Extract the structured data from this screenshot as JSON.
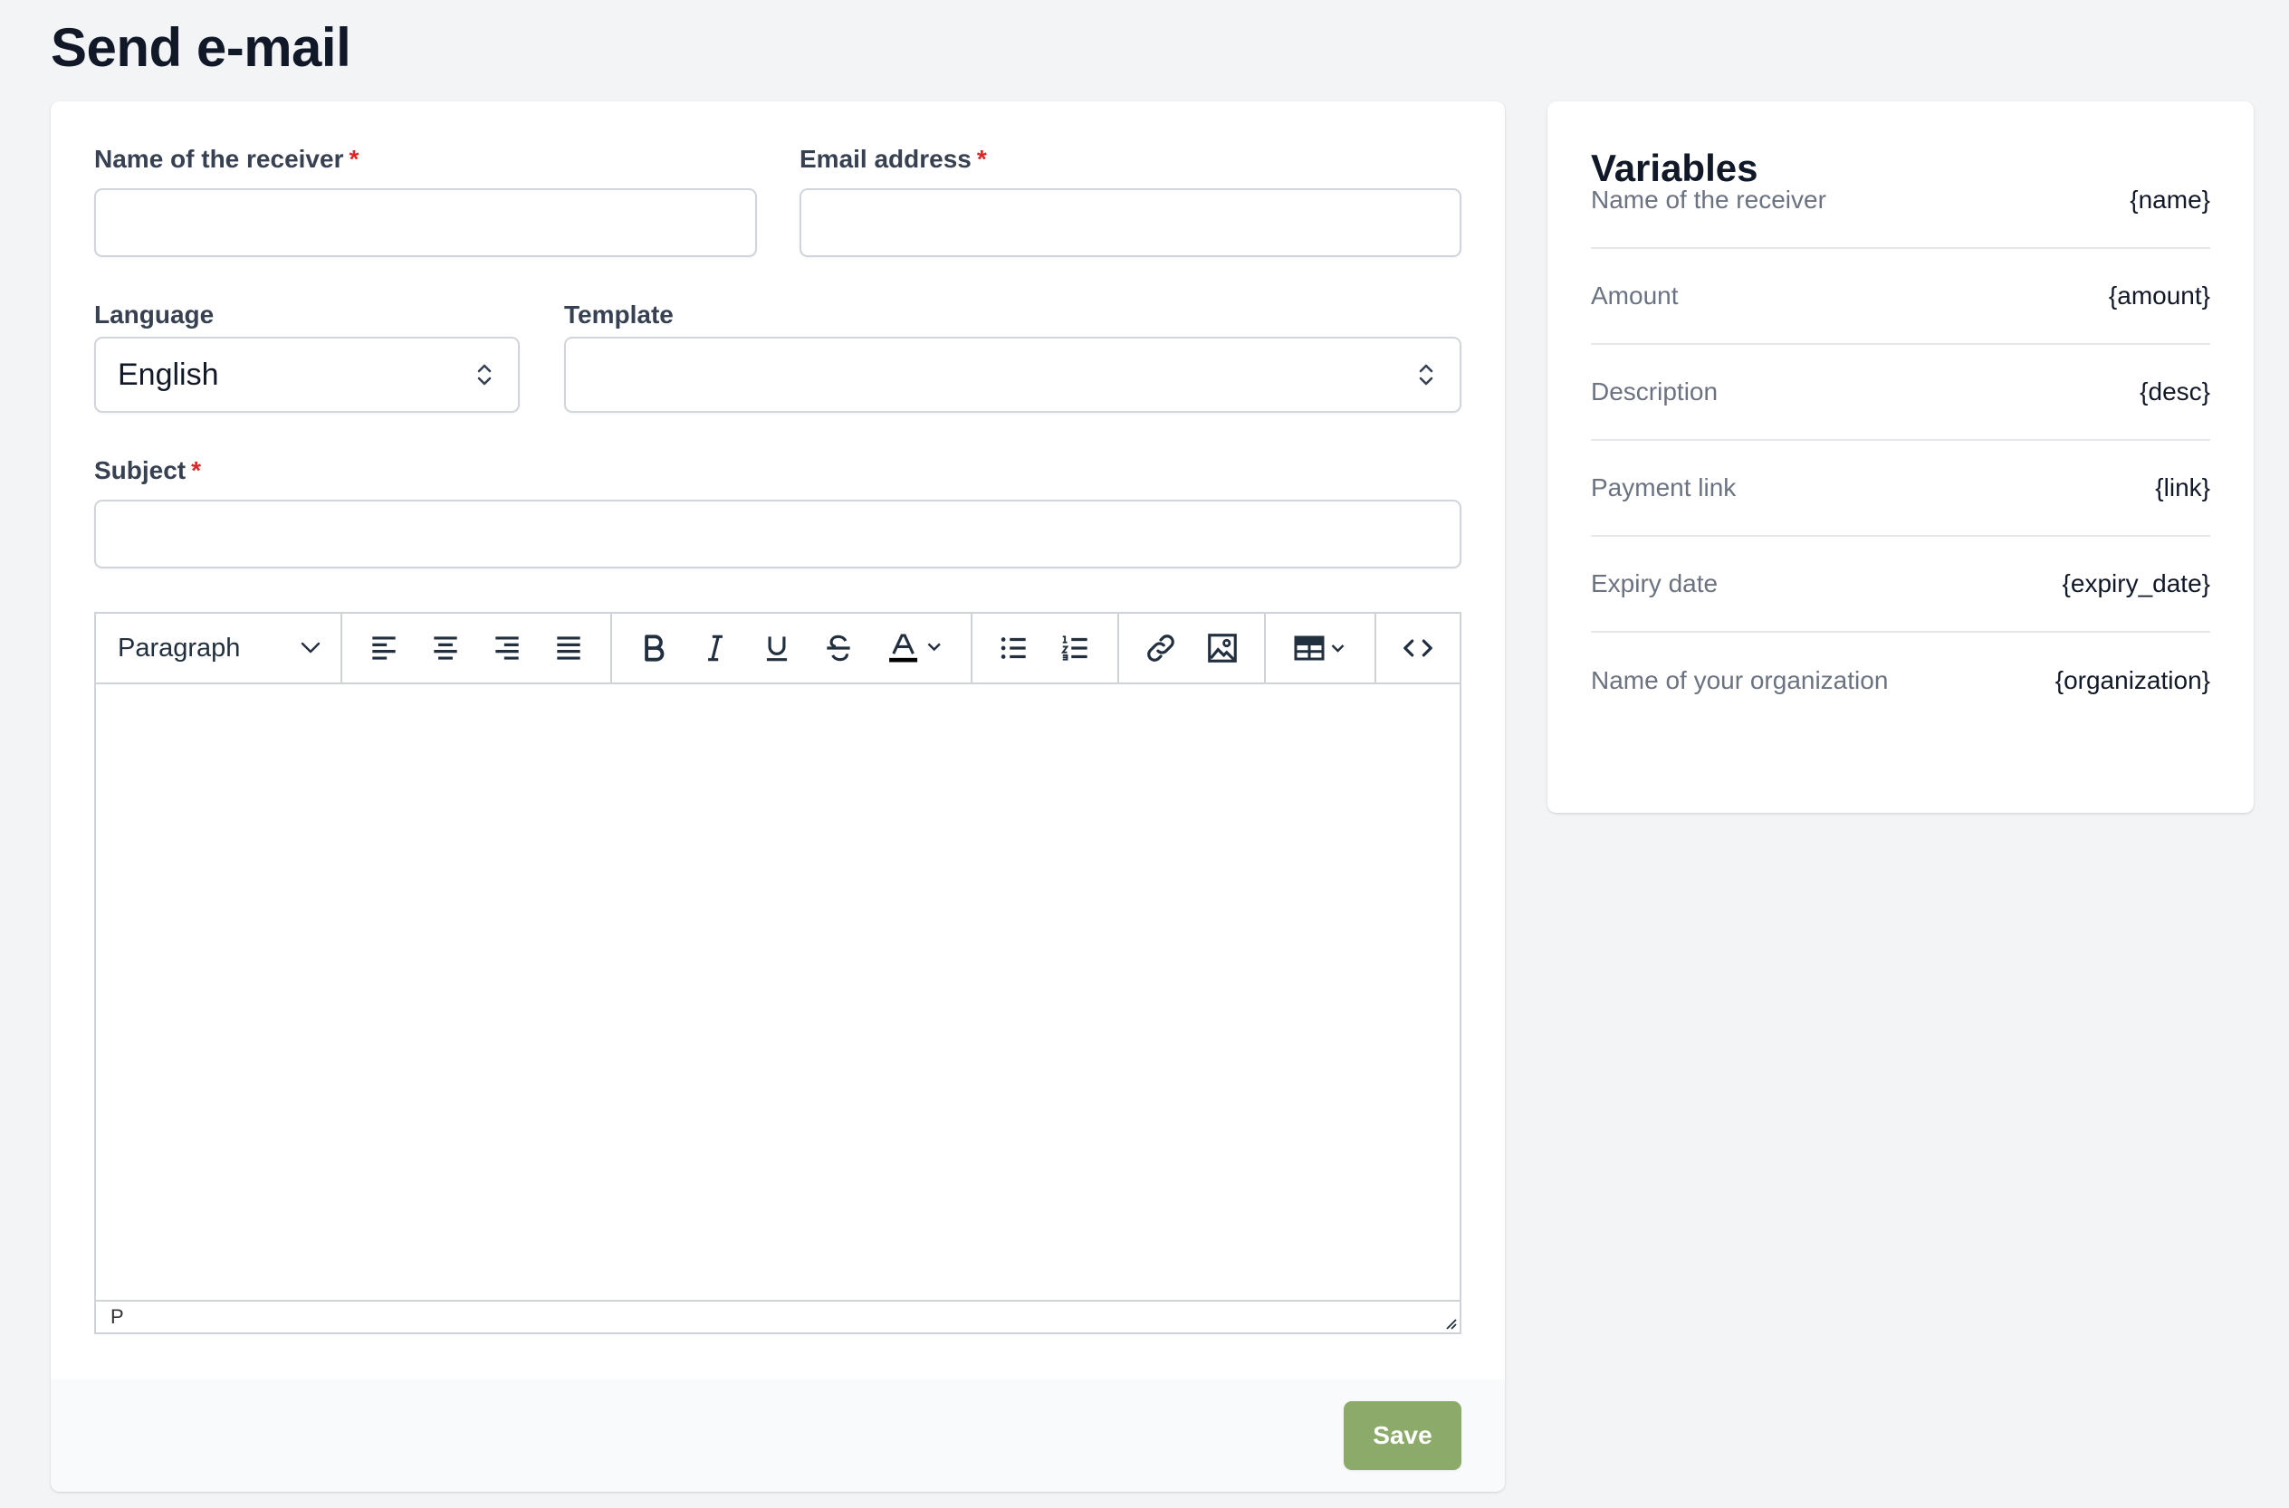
{
  "page": {
    "title": "Send e-mail"
  },
  "form": {
    "receiver_label": "Name of the receiver",
    "receiver_value": "",
    "email_label": "Email address",
    "email_value": "",
    "required_mark": "*",
    "language_label": "Language",
    "language_value": "English",
    "template_label": "Template",
    "template_value": "",
    "subject_label": "Subject",
    "subject_value": ""
  },
  "editor": {
    "block_format": "Paragraph",
    "statusbar_path": "P",
    "toolbar_icons": [
      "align-left-icon",
      "align-center-icon",
      "align-right-icon",
      "align-justify-icon",
      "bold-icon",
      "italic-icon",
      "underline-icon",
      "strikethrough-icon",
      "text-color-icon",
      "bullet-list-icon",
      "numbered-list-icon",
      "link-icon",
      "image-icon",
      "table-icon",
      "source-code-icon"
    ]
  },
  "footer": {
    "save_label": "Save"
  },
  "variables": {
    "title": "Variables",
    "items": [
      {
        "name": "Name of the receiver",
        "token": "{name}"
      },
      {
        "name": "Amount",
        "token": "{amount}"
      },
      {
        "name": "Description",
        "token": "{desc}"
      },
      {
        "name": "Payment link",
        "token": "{link}"
      },
      {
        "name": "Expiry date",
        "token": "{expiry_date}"
      },
      {
        "name": "Name of your organization",
        "token": "{organization}"
      }
    ]
  },
  "colors": {
    "accent": "#8caa6a",
    "required": "#dc2626",
    "background": "#f3f4f6"
  }
}
